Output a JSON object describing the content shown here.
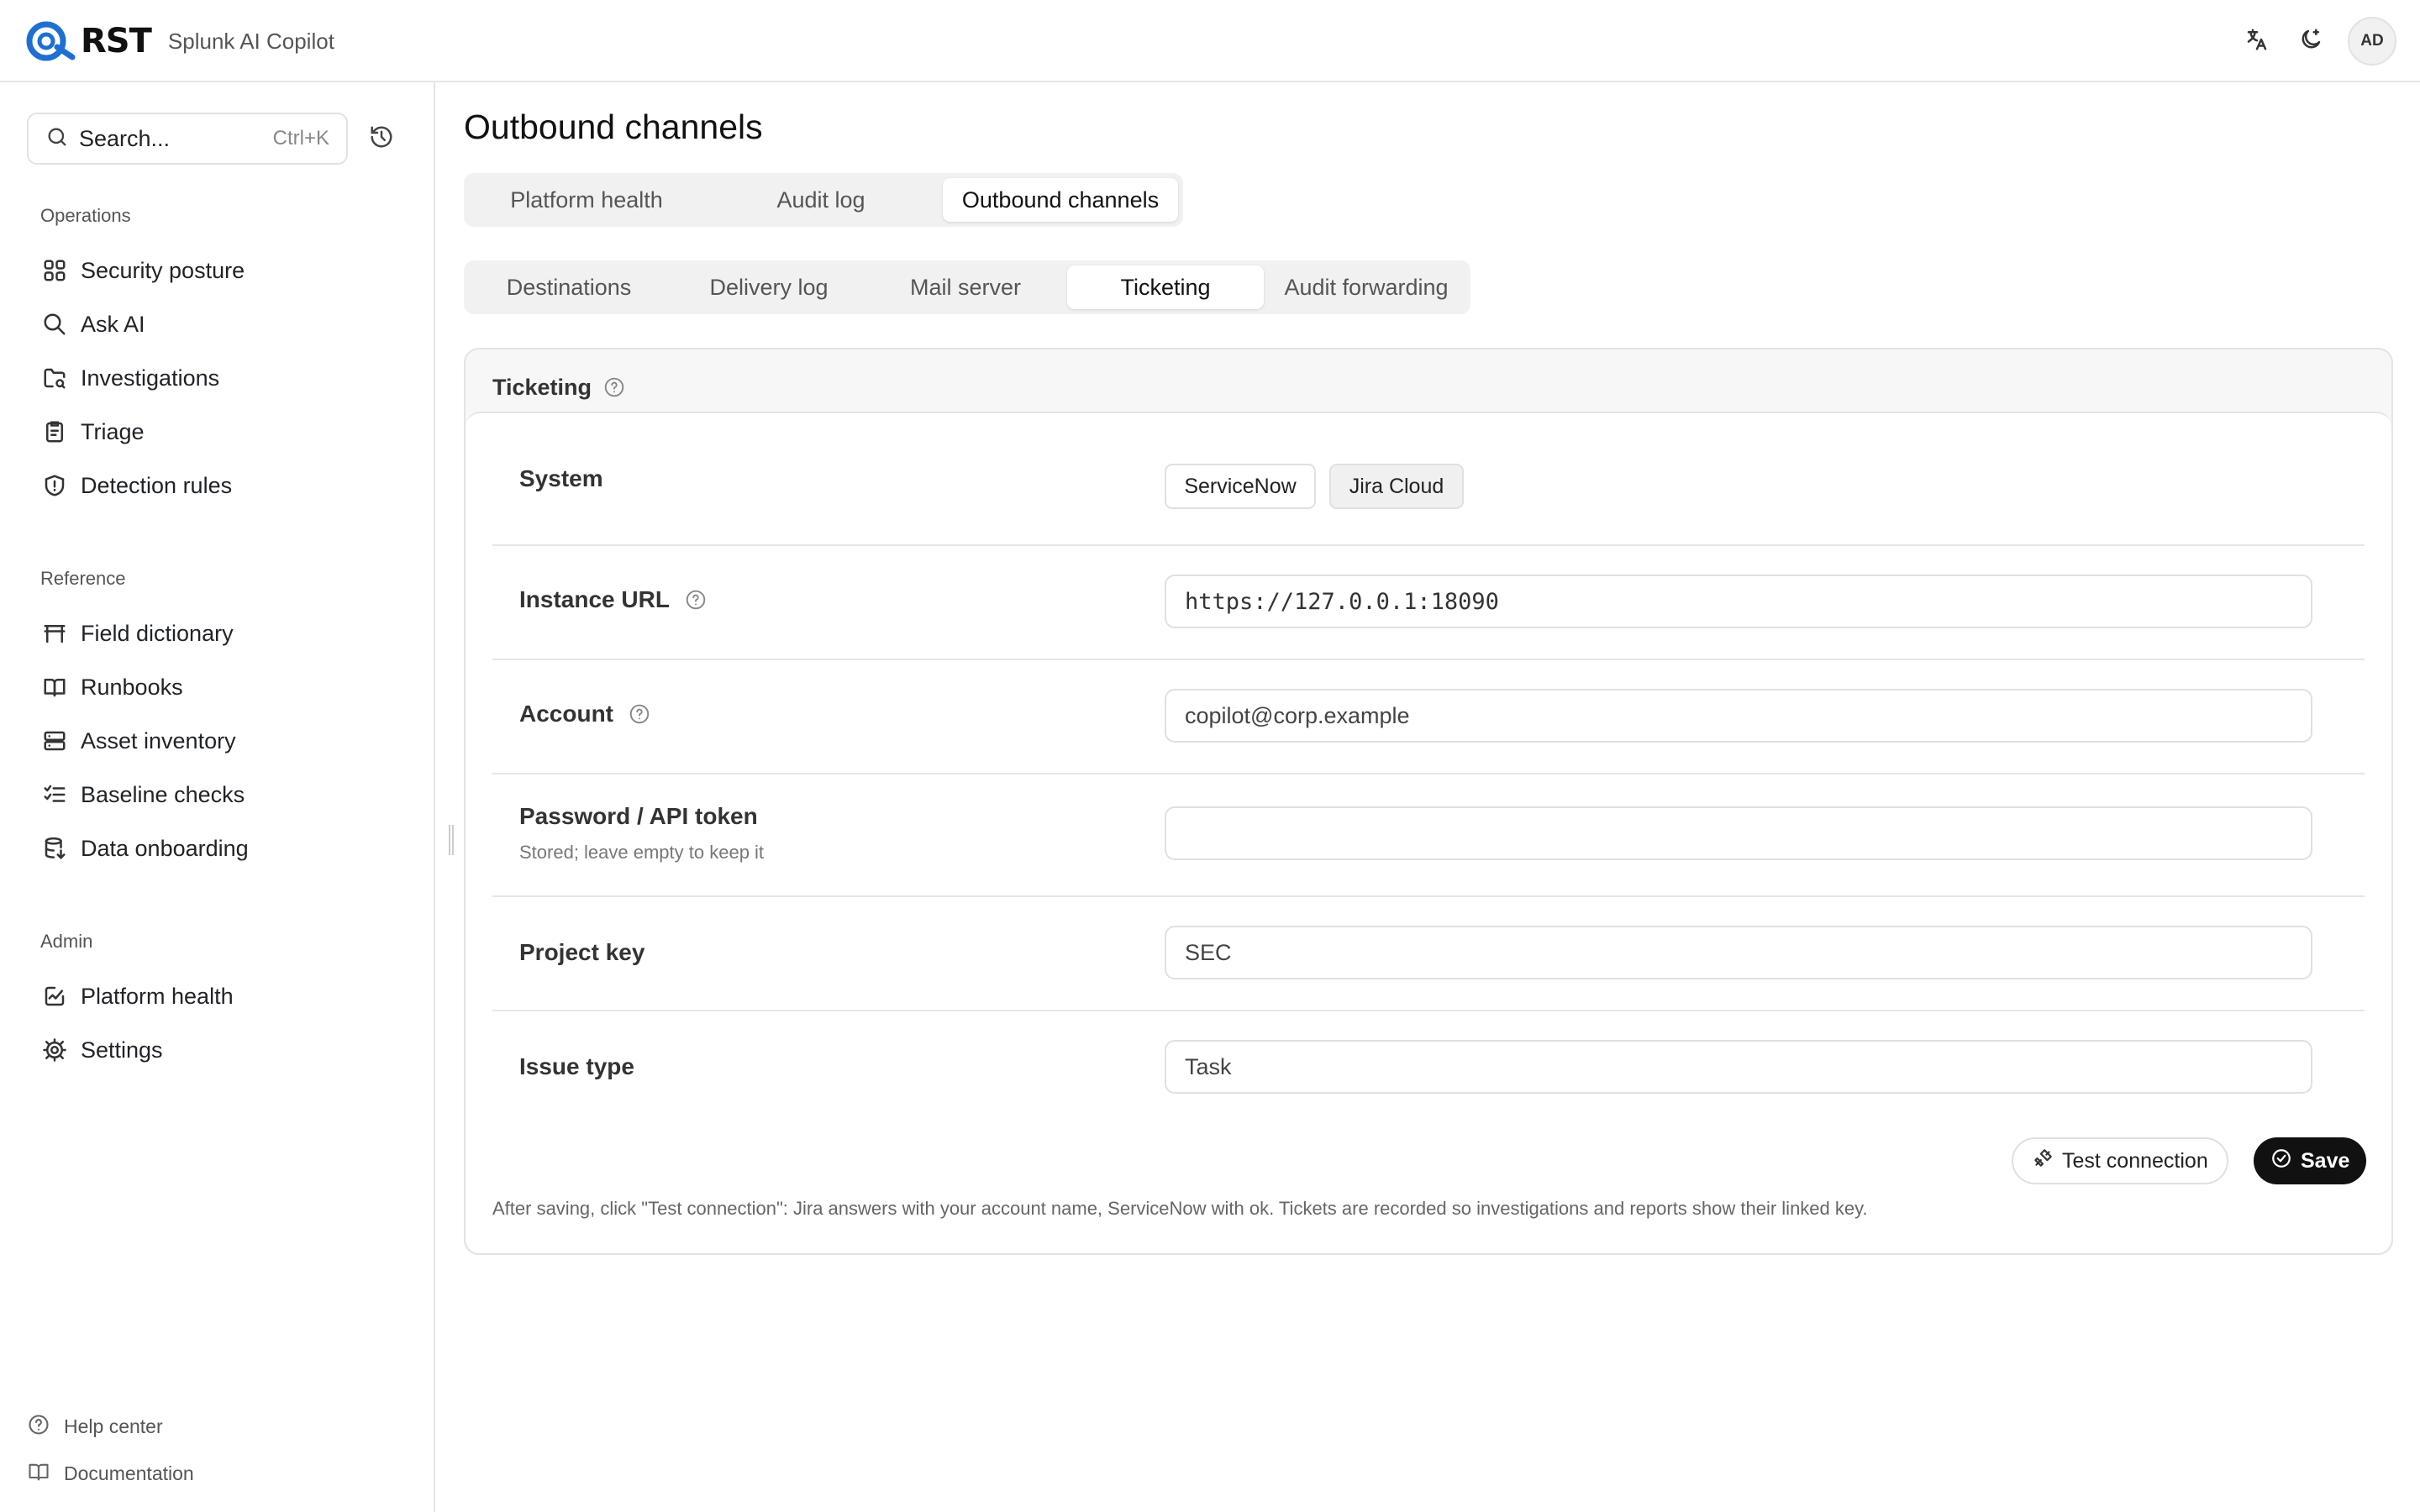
{
  "app": {
    "brand_word": "RST",
    "product_name": "Splunk AI Copilot",
    "avatar_initials": "AD"
  },
  "sidebar": {
    "search_placeholder": "Search...",
    "search_shortcut": "Ctrl+K",
    "sections": [
      {
        "title": "Operations",
        "items": [
          {
            "label": "Security posture",
            "icon": "grid-icon"
          },
          {
            "label": "Ask AI",
            "icon": "search-icon"
          },
          {
            "label": "Investigations",
            "icon": "folder-search-icon"
          },
          {
            "label": "Triage",
            "icon": "clipboard-icon"
          },
          {
            "label": "Detection rules",
            "icon": "shield-icon"
          }
        ]
      },
      {
        "title": "Reference",
        "items": [
          {
            "label": "Field dictionary",
            "icon": "table-icon"
          },
          {
            "label": "Runbooks",
            "icon": "book-icon"
          },
          {
            "label": "Asset inventory",
            "icon": "server-icon"
          },
          {
            "label": "Baseline checks",
            "icon": "list-checks-icon"
          },
          {
            "label": "Data onboarding",
            "icon": "database-icon"
          }
        ]
      },
      {
        "title": "Admin",
        "items": [
          {
            "label": "Platform health",
            "icon": "activity-icon"
          },
          {
            "label": "Settings",
            "icon": "gear-icon"
          }
        ]
      }
    ],
    "footer": [
      {
        "label": "Help center",
        "icon": "help-icon"
      },
      {
        "label": "Documentation",
        "icon": "book-icon"
      }
    ]
  },
  "main": {
    "title": "Outbound channels",
    "primary_tabs": [
      {
        "label": "Platform health",
        "active": false
      },
      {
        "label": "Audit log",
        "active": false
      },
      {
        "label": "Outbound channels",
        "active": true
      }
    ],
    "secondary_tabs": [
      {
        "label": "Destinations",
        "active": false
      },
      {
        "label": "Delivery log",
        "active": false
      },
      {
        "label": "Mail server",
        "active": false
      },
      {
        "label": "Ticketing",
        "active": true
      },
      {
        "label": "Audit forwarding",
        "active": false
      }
    ],
    "card": {
      "title": "Ticketing",
      "system_label": "System",
      "system_options": [
        {
          "label": "ServiceNow",
          "selected": false
        },
        {
          "label": "Jira Cloud",
          "selected": true
        }
      ],
      "fields": {
        "instance_url": {
          "label": "Instance URL",
          "value": "https://127.0.0.1:18090"
        },
        "account": {
          "label": "Account",
          "value": "copilot@corp.example"
        },
        "password": {
          "label": "Password / API token",
          "hint": "Stored; leave empty to keep it",
          "value": ""
        },
        "project_key": {
          "label": "Project key",
          "value": "SEC"
        },
        "issue_type": {
          "label": "Issue type",
          "value": "Task"
        }
      },
      "test_button": "Test connection",
      "save_button": "Save",
      "footnote": "After saving, click \"Test connection\": Jira answers with your account name, ServiceNow with ok. Tickets are recorded so investigations and reports show their linked key."
    }
  },
  "colors": {
    "accent_logo": "#1f6fd1",
    "primary_button": "#111111",
    "tab_track": "#f1f1f1"
  }
}
